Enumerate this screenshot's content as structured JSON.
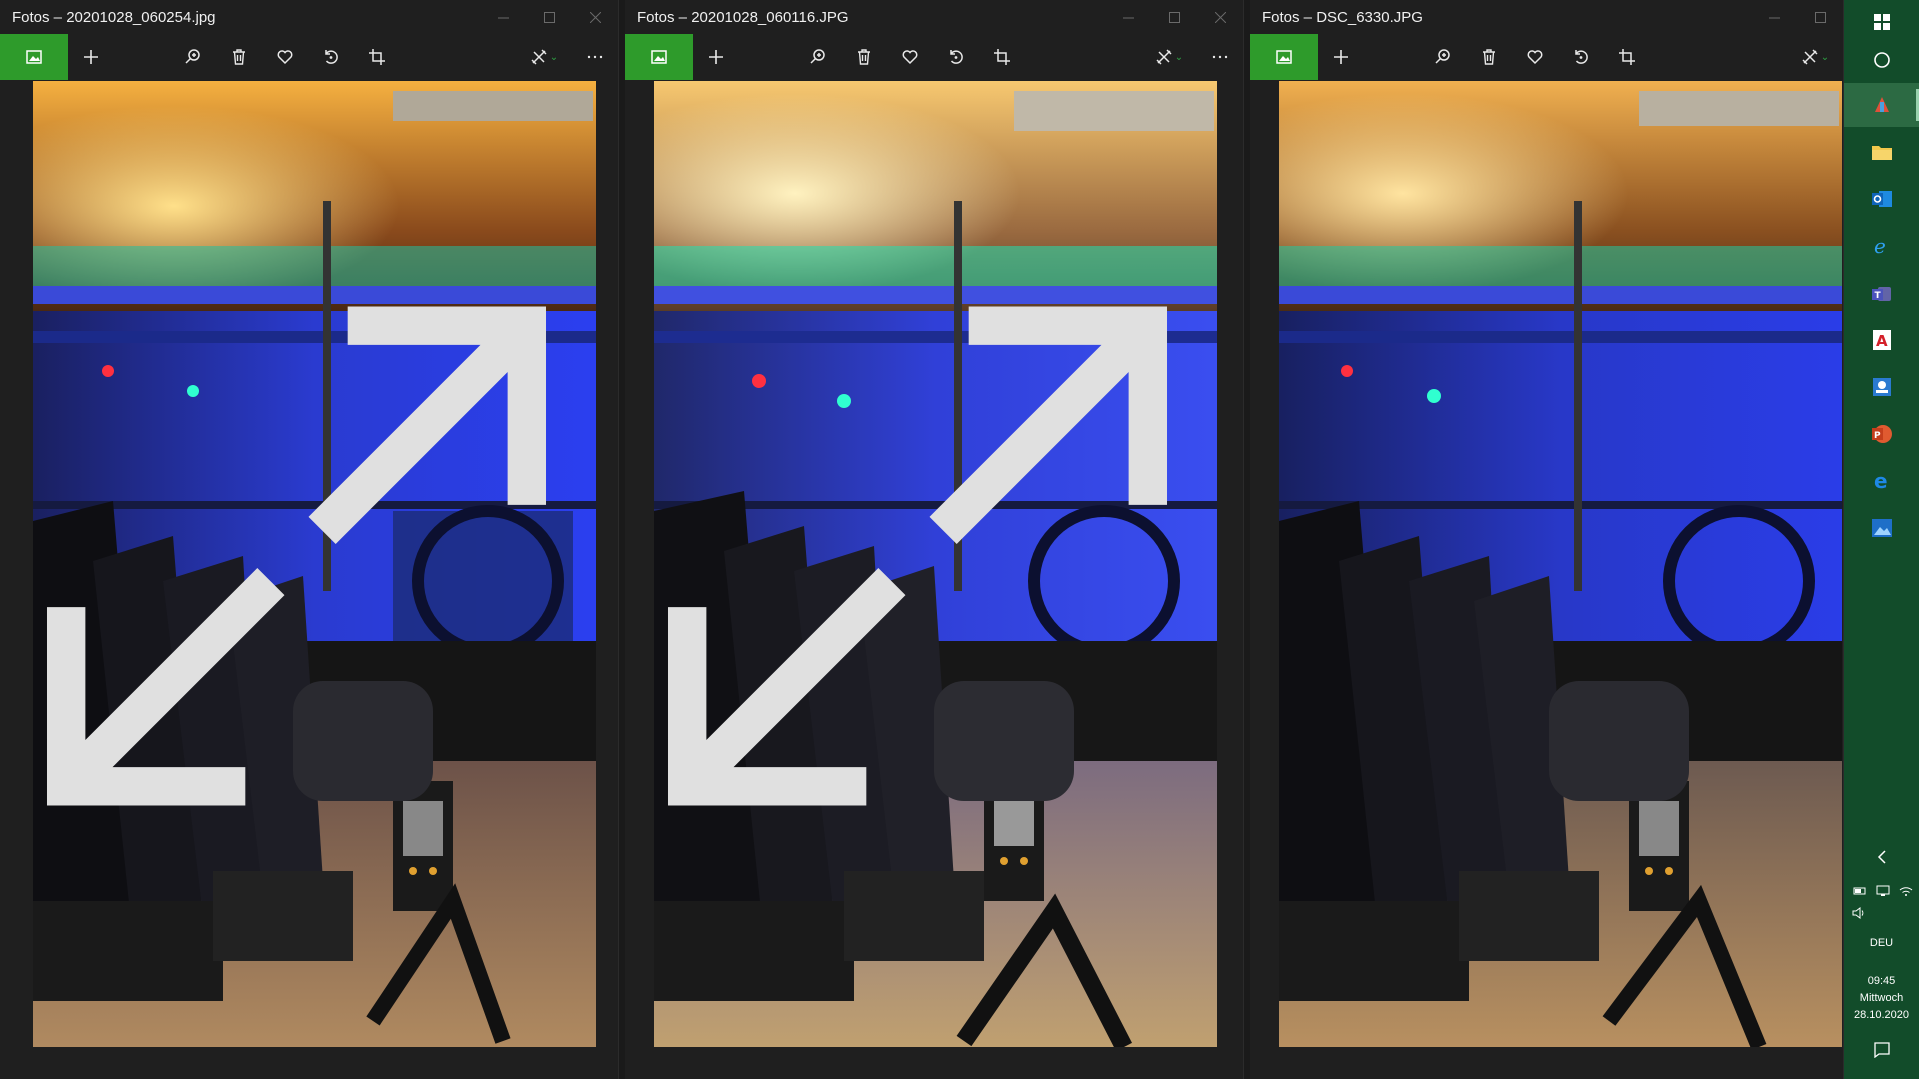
{
  "windows": [
    {
      "title": "Fotos – 20201028_060254.jpg"
    },
    {
      "title": "Fotos – 20201028_060116.JPG"
    },
    {
      "title": "Fotos – DSC_6330.JPG"
    }
  ],
  "colors": {
    "photos_accent": "#2e9b2b",
    "taskbar": "#124c2a",
    "window_bg": "#1f1f1f"
  },
  "toolbar_icons": [
    "photos-app-icon",
    "add-icon",
    "zoom-icon",
    "delete-icon",
    "favorite-icon",
    "rotate-icon",
    "crop-icon",
    "edit-create-icon",
    "more-icon"
  ],
  "taskbar": {
    "icons": [
      "start-icon",
      "search-circle-icon",
      "app-pinned-icon",
      "file-explorer-icon",
      "outlook-icon",
      "internet-explorer-icon",
      "teams-icon",
      "acrobat-icon",
      "lync-icon",
      "powerpoint-icon",
      "edge-icon",
      "photos-icon"
    ],
    "tray": {
      "language": "DEU",
      "time": "09:45",
      "weekday": "Mittwoch",
      "date": "28.10.2020"
    }
  }
}
